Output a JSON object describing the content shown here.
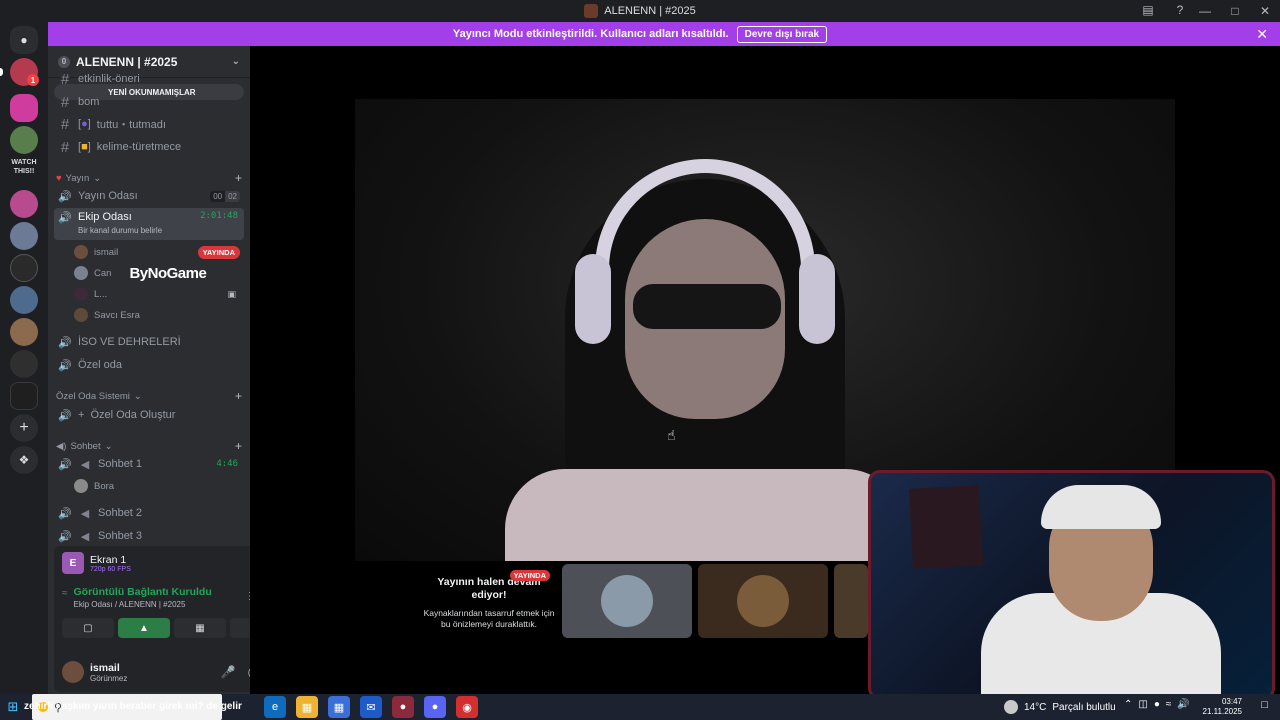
{
  "window": {
    "title": "ALENENN | #2025"
  },
  "banner": {
    "message": "Yayıncı Modu etkinleştirildi. Kullanıcı adları kısaltıldı.",
    "button": "Devre dışı bırak"
  },
  "rail": {
    "badge_count": "1",
    "watch_label": "WATCH\nTHIS!!"
  },
  "sidebar": {
    "server_name": "ALENENN | #2025",
    "boost_count": "0",
    "unread_pill": "YENİ OKUNMAMIŞLAR",
    "text_channels": [
      {
        "name": "etkinlik-öneri"
      },
      {
        "name": "bom"
      },
      {
        "name": "tuttu・tutmadı"
      },
      {
        "name": "kelime-türetmece"
      }
    ],
    "categories": {
      "yayin": "Yayın",
      "ozel_oda_sistemi": "Özel Oda Sistemi",
      "sohbet": "Sohbet"
    },
    "voice": {
      "yayin_odasi": {
        "name": "Yayın Odası",
        "left": "00",
        "right": "02"
      },
      "ekip_odasi": {
        "name": "Ekip Odası",
        "timer": "2:01:48",
        "status": "Bir kanal durumu belirle"
      },
      "iso": {
        "name": "İSO VE DEHRELERİ"
      },
      "ozel_oda": {
        "name": "Özel oda"
      },
      "olustur": {
        "name": "Özel Oda Oluştur"
      },
      "sohbet1": {
        "name": "Sohbet 1",
        "timer": "4:46"
      },
      "sohbet2": {
        "name": "Sohbet 2"
      },
      "sohbet3": {
        "name": "Sohbet 3"
      }
    },
    "ekip_members": [
      {
        "name": "ismail",
        "badge": "YAYINDA"
      },
      {
        "name": "Can"
      },
      {
        "name": "L..."
      },
      {
        "name": "Savcı Esra"
      }
    ],
    "sohbet1_members": [
      {
        "name": "Bora"
      }
    ],
    "overlay_logo": "ByNoGame"
  },
  "screen_panel": {
    "icon_letter": "E",
    "title": "Ekran 1",
    "quality": "720p 60 FPS"
  },
  "rtc": {
    "status": "Görüntülü Bağlantı Kuruldu",
    "location": "Ekip Odası / ALENENN | #2025"
  },
  "user_panel": {
    "name": "ismail",
    "status": "Görünmez"
  },
  "stage": {
    "note_badge": "YAYINDA",
    "note_head": "Yayının halen devam ediyor!",
    "note_body": "Kaynaklarından tasarruf etmek için bu önizlemeyi duraklattık."
  },
  "taskbar": {
    "ticker": "zehirli : aşkım yarın beraber girek mi? de gelir",
    "weather_temp": "14°C",
    "weather_desc": "Parçalı bulutlu",
    "time": "03:47",
    "date": "21.11.2025"
  },
  "colors": {
    "accent": "#a23fe8",
    "live": "#da373c",
    "online": "#23a55a"
  }
}
